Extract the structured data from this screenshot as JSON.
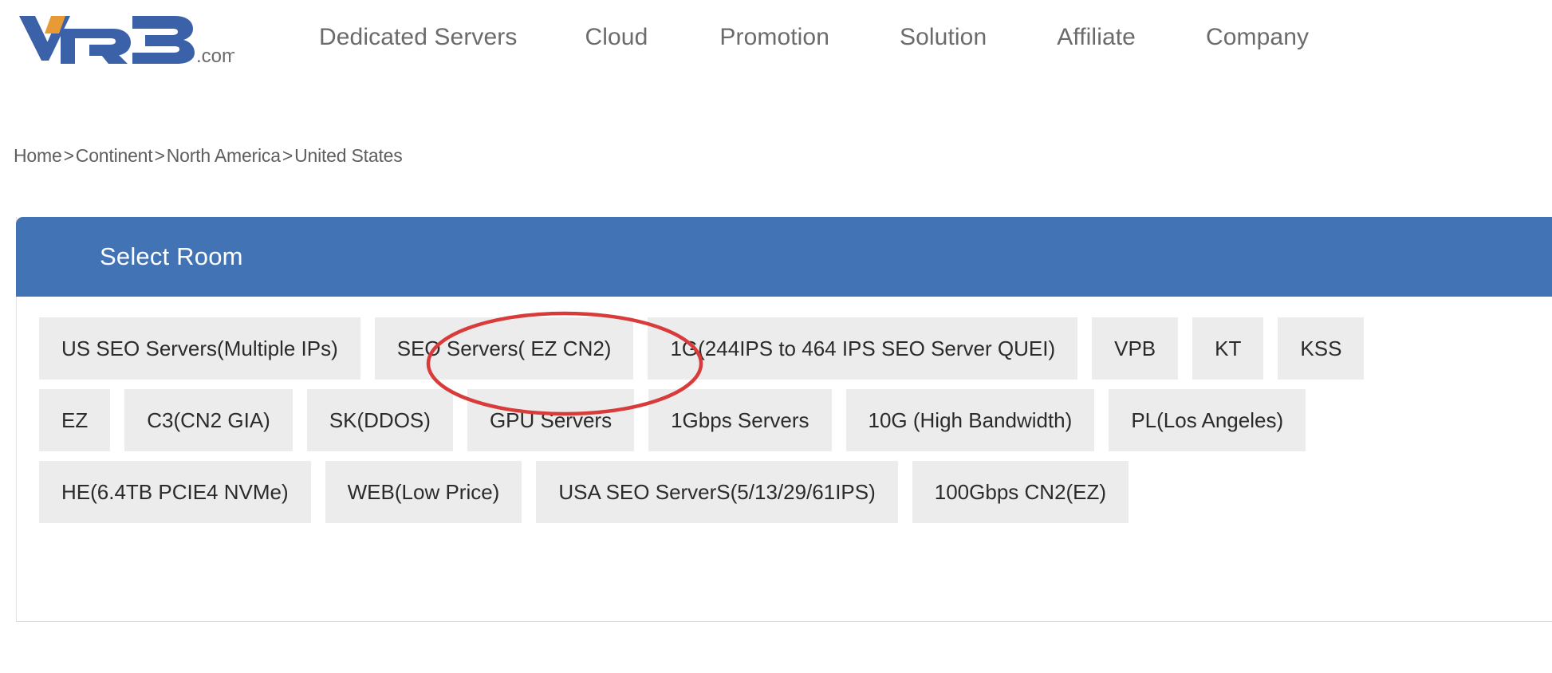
{
  "site": {
    "logo_text": "VPB",
    "logo_suffix": ".com",
    "logo_colors": {
      "primary": "#3b62a8",
      "accent": "#e89b34"
    }
  },
  "nav": {
    "items": [
      {
        "label": "Dedicated Servers"
      },
      {
        "label": "Cloud"
      },
      {
        "label": "Promotion"
      },
      {
        "label": "Solution"
      },
      {
        "label": "Affiliate"
      },
      {
        "label": "Company"
      }
    ]
  },
  "breadcrumb": {
    "separator": ">",
    "items": [
      {
        "label": "Home"
      },
      {
        "label": "Continent"
      },
      {
        "label": "North America"
      },
      {
        "label": "United States"
      }
    ]
  },
  "panel": {
    "title": "Select Room",
    "header_color": "#4274b5",
    "tag_background": "#ececec",
    "rows": [
      {
        "tags": [
          {
            "label": "US SEO Servers(Multiple IPs)"
          },
          {
            "label": "SEO Servers( EZ CN2)",
            "annotated": true
          },
          {
            "label": "1G(244IPS to 464 IPS SEO Server QUEI)"
          },
          {
            "label": "VPB"
          },
          {
            "label": "KT"
          },
          {
            "label": "KSS"
          }
        ]
      },
      {
        "tags": [
          {
            "label": "EZ"
          },
          {
            "label": "C3(CN2 GIA)"
          },
          {
            "label": "SK(DDOS)"
          },
          {
            "label": "GPU Servers"
          },
          {
            "label": "1Gbps Servers"
          },
          {
            "label": "10G (High Bandwidth)"
          },
          {
            "label": "PL(Los Angeles)"
          }
        ]
      },
      {
        "tags": [
          {
            "label": "HE(6.4TB PCIE4 NVMe)"
          },
          {
            "label": "WEB(Low Price)"
          },
          {
            "label": "USA SEO ServerS(5/13/29/61IPS)"
          },
          {
            "label": "100Gbps CN2(EZ)"
          }
        ]
      }
    ]
  },
  "annotation": {
    "type": "ellipse",
    "color": "#d93a3a",
    "target_label": "SEO Servers( EZ CN2)"
  }
}
